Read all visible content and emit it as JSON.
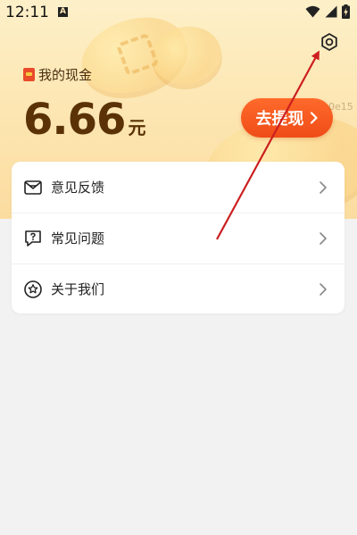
{
  "status_bar": {
    "time": "12:11",
    "app_icon_letter": "A"
  },
  "cash": {
    "label": "我的现金",
    "amount": "6.66",
    "unit": "元",
    "withdraw_label": "去提现",
    "side_text": "0e15"
  },
  "menu": {
    "items": [
      {
        "label": "意见反馈",
        "icon": "feedback-mail-icon"
      },
      {
        "label": "常见问题",
        "icon": "faq-chat-icon"
      },
      {
        "label": "关于我们",
        "icon": "about-star-icon"
      }
    ]
  },
  "colors": {
    "accent": "#ef4c17",
    "amount": "#5a3206",
    "annotation_arrow": "#cc1e1e"
  }
}
